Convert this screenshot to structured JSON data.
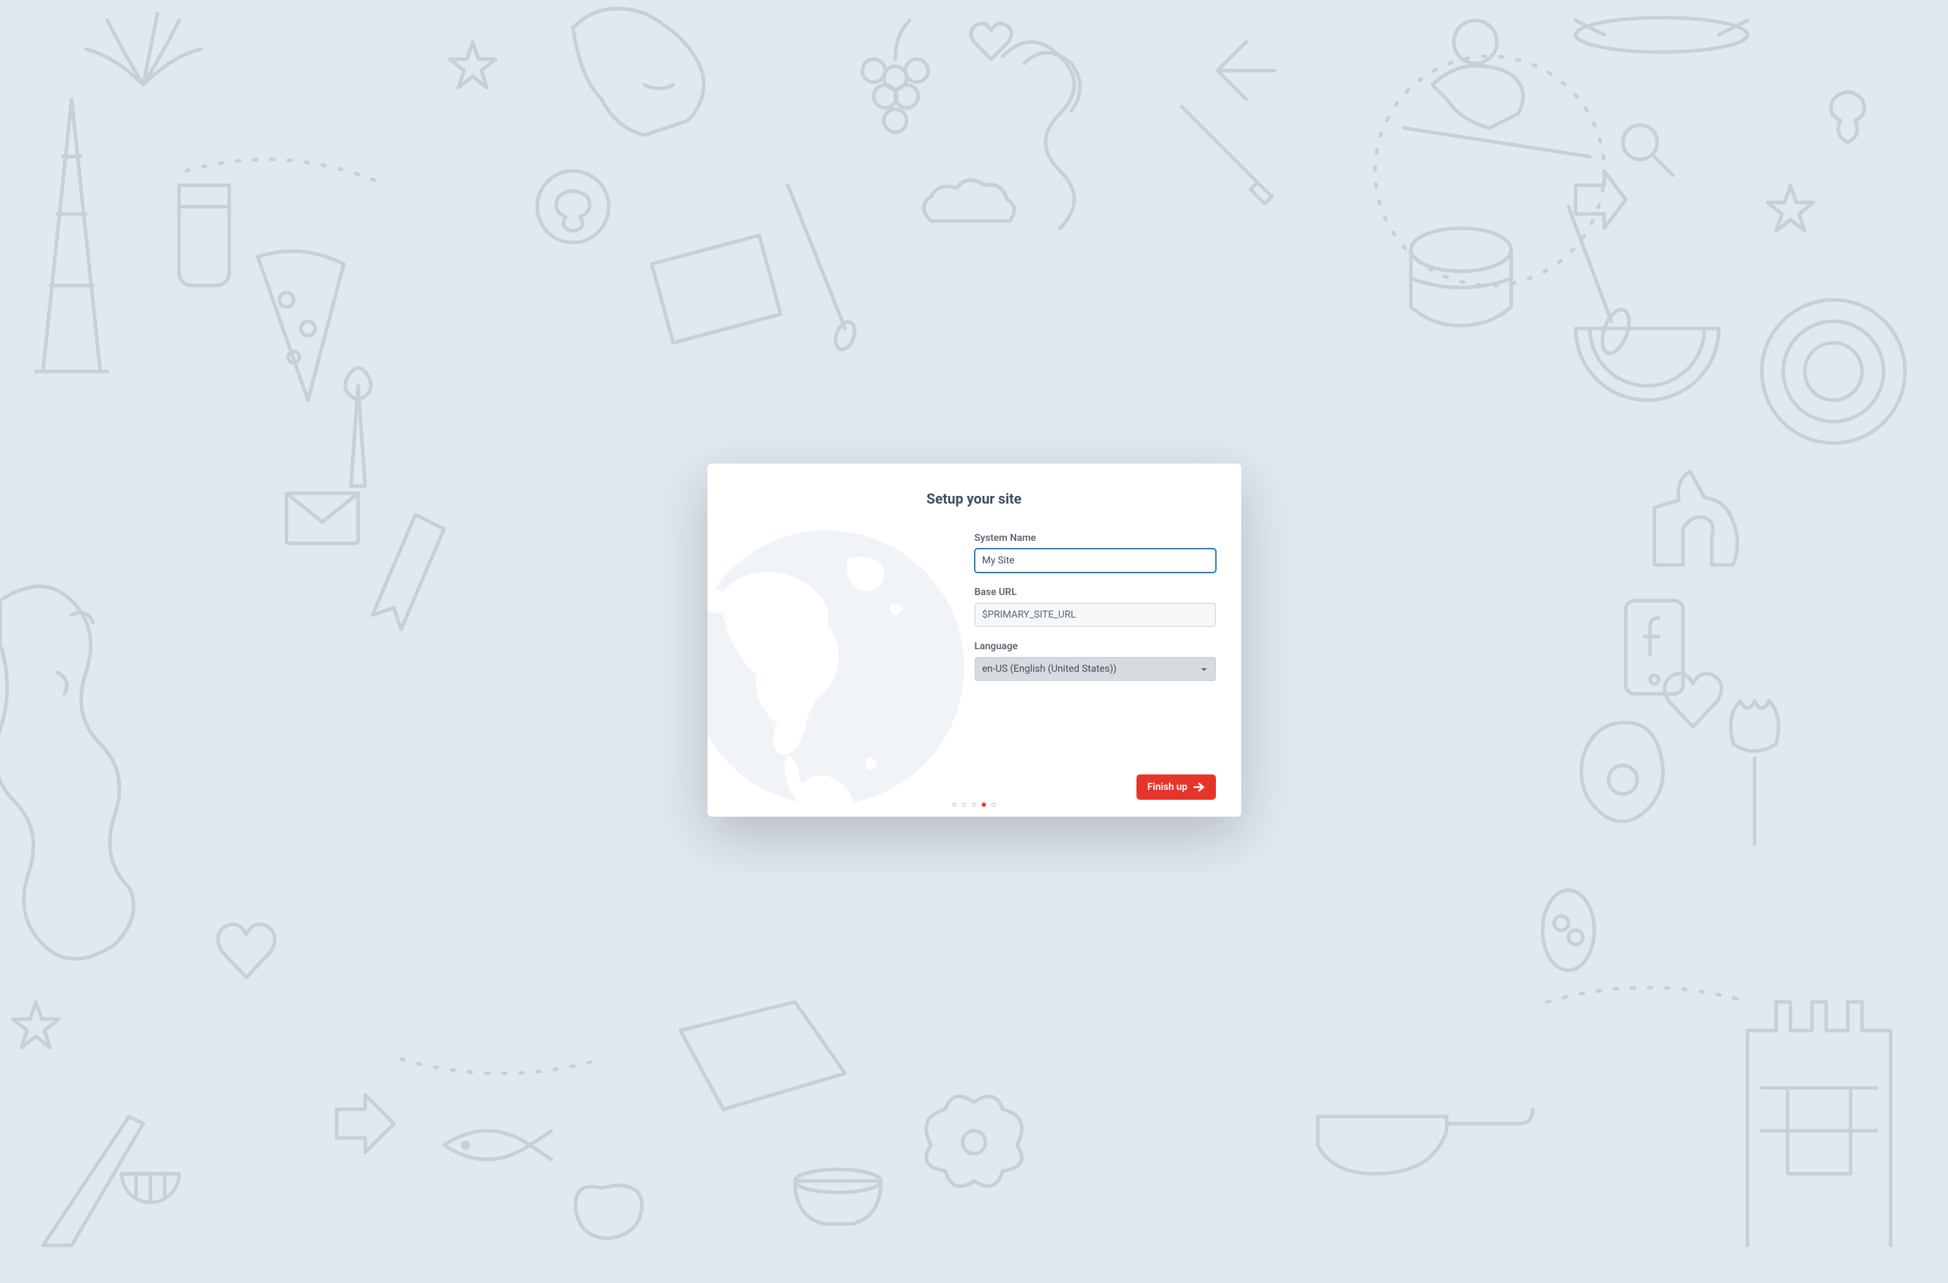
{
  "modal": {
    "title": "Setup your site",
    "fields": {
      "system_name": {
        "label": "System Name",
        "value": "My Site"
      },
      "base_url": {
        "label": "Base URL",
        "value": "$PRIMARY_SITE_URL"
      },
      "language": {
        "label": "Language",
        "selected": "en-US (English (United States))"
      }
    },
    "button": {
      "finish_label": "Finish up"
    },
    "pagination": {
      "total": 5,
      "active": 4
    }
  }
}
